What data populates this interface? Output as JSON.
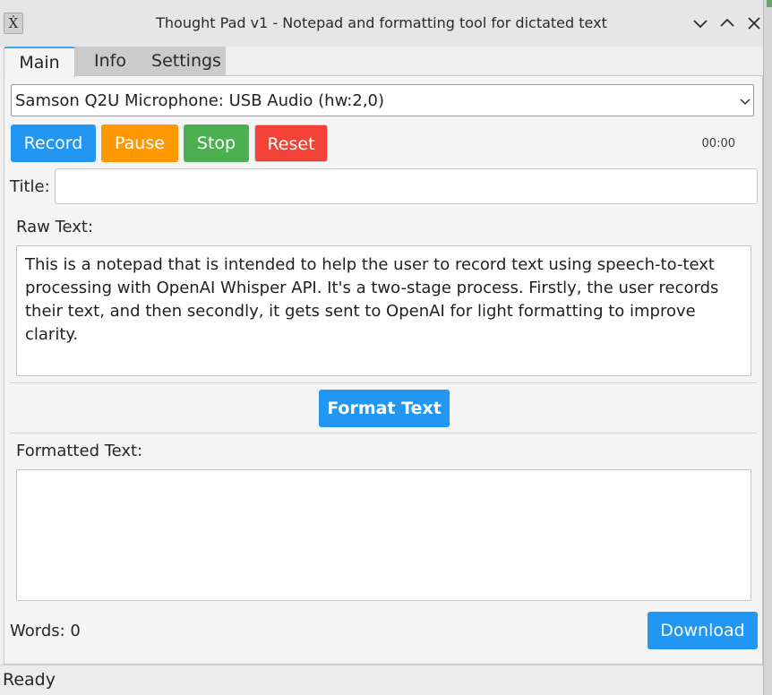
{
  "window": {
    "title": "Thought Pad v1 - Notepad and formatting tool for dictated text",
    "icon_glyph": "Ẋ"
  },
  "tabs": [
    {
      "label": "Main",
      "active": true
    },
    {
      "label": "Info",
      "active": false
    },
    {
      "label": "Settings",
      "active": false
    }
  ],
  "device": {
    "selected": "Samson Q2U Microphone: USB Audio (hw:2,0)"
  },
  "controls": {
    "record_label": "Record",
    "pause_label": "Pause",
    "stop_label": "Stop",
    "reset_label": "Reset",
    "timer": "00:00",
    "colors": {
      "record": "#2196f3",
      "pause": "#ff9800",
      "stop": "#4caf50",
      "reset": "#f44336"
    }
  },
  "title_field": {
    "label": "Title:",
    "value": ""
  },
  "raw_text": {
    "label": "Raw Text:",
    "value": "This is a notepad that is intended to help the user to record text using speech-to-text processing with OpenAI Whisper API. It's a two-stage process. Firstly, the user records their text, and then secondly, it gets sent to OpenAI for light formatting to improve clarity."
  },
  "format_button_label": "Format Text",
  "formatted_text": {
    "label": "Formatted Text:",
    "value": ""
  },
  "footer": {
    "word_count": "Words: 0",
    "download_label": "Download"
  },
  "status": "Ready",
  "icons": {
    "minimize": "chevron-down-icon",
    "maximize": "chevron-up-icon",
    "close": "close-icon",
    "dropdown": "chevron-down-icon"
  }
}
